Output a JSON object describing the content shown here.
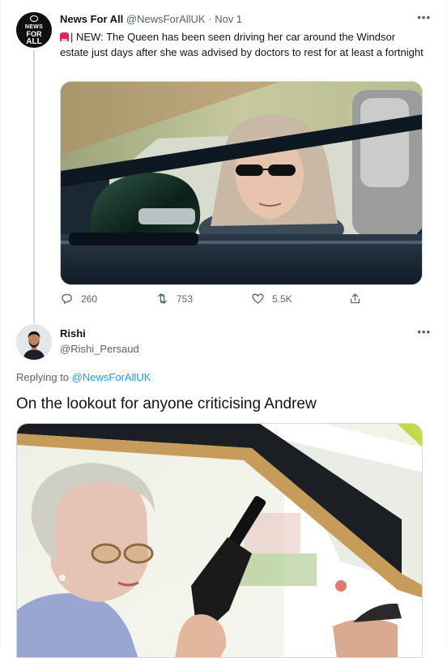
{
  "parent_tweet": {
    "avatar_text": [
      "NEWS",
      "FOR",
      "ALL"
    ],
    "display_name": "News For All",
    "handle": "@NewsForAllUK",
    "separator": "·",
    "date": "Nov 1",
    "more_icon": "•••",
    "text_icon": "rotating-light-emoji",
    "text": "| NEW: The Queen has been seen driving her car around the Windsor estate just days after she was advised by doctors to rest for at least a fortnight",
    "stats": {
      "replies": "260",
      "retweets": "753",
      "likes": "5.5K"
    }
  },
  "reply_tweet": {
    "display_name": "Rishi",
    "handle": "@Rishi_Persaud",
    "more_icon": "•••",
    "replying_to_label": "Replying to",
    "replying_to_handle": "@NewsForAllUK",
    "text": "On the lookout for anyone criticising Andrew"
  },
  "colors": {
    "accent": "#1d9bf0",
    "secondary_text": "#536471",
    "primary_text": "#0f1419",
    "border": "#cfd9de"
  }
}
